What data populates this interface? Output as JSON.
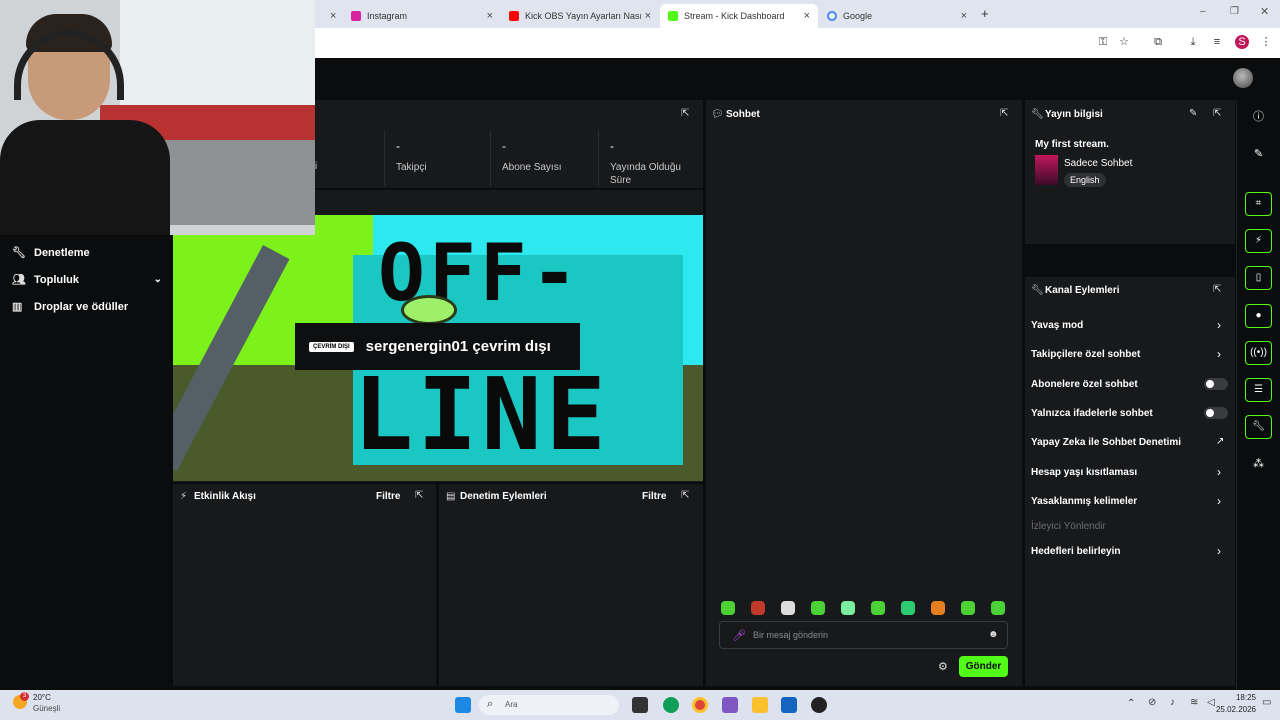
{
  "browser": {
    "tabs": [
      {
        "title": "Instagram",
        "icon_color": "#d6249f"
      },
      {
        "title": "Kick OBS Yayın Ayarları Nasıl Ya",
        "icon_color": "#ff0000"
      },
      {
        "title": "Stream - Kick Dashboard",
        "icon_color": "#53fc18"
      },
      {
        "title": "Google",
        "icon_color": "#4285f4"
      }
    ],
    "new_tab": "+",
    "profile_initial": "S"
  },
  "stats": {
    "followers_label": "Takipçi",
    "followers_value": "-",
    "subs_label": "Abone Sayısı",
    "subs_value": "-",
    "live_label": "Yayında Olduğu Süre",
    "live_value": "-",
    "partial_label": "i"
  },
  "nav": {
    "items": [
      "Denetleme",
      "Topluluk",
      "Droplar ve ödüller"
    ]
  },
  "offline": {
    "word_top": "OFF-",
    "word_bottom": "LINE",
    "tag": "ÇEVRİM DIŞI",
    "text": "sergenergin01 çevrim dışı"
  },
  "activity": {
    "title": "Etkinlik Akışı",
    "filter": "Filtre"
  },
  "moderation": {
    "title": "Denetim Eylemleri",
    "filter": "Filtre"
  },
  "chat": {
    "title": "Sohbet",
    "placeholder": "Bir mesaj gönderin",
    "send": "Gönder"
  },
  "stream_info": {
    "title": "Yayın bilgisi",
    "stream_title": "My first stream.",
    "category": "Sadece Sohbet",
    "language": "English"
  },
  "channel_actions": {
    "title": "Kanal Eylemleri",
    "items": [
      {
        "label": "Yavaş mod",
        "control": "chevron"
      },
      {
        "label": "Takipçilere özel sohbet",
        "control": "chevron"
      },
      {
        "label": "Abonelere özel sohbet",
        "control": "toggle"
      },
      {
        "label": "Yalnızca ifadelerle sohbet",
        "control": "toggle"
      },
      {
        "label": "Yapay Zeka ile Sohbet Denetimi",
        "control": "external"
      },
      {
        "label": "Hesap yaşı kısıtlaması",
        "control": "chevron"
      },
      {
        "label": "Yasaklanmış kelimeler",
        "control": "chevron"
      },
      {
        "label": "İzleyici Yönlendir",
        "control": "none"
      },
      {
        "label": "Hedefleri belirleyin",
        "control": "chevron"
      }
    ]
  },
  "taskbar": {
    "weather_temp": "20°C",
    "weather_desc": "Güneşli",
    "weather_badge": "3",
    "search": "Ara",
    "time": "18:25",
    "date": "25.02.2026"
  },
  "colors": {
    "accent": "#53fc18",
    "panel": "#18191b",
    "bg": "#0b0c0d"
  }
}
